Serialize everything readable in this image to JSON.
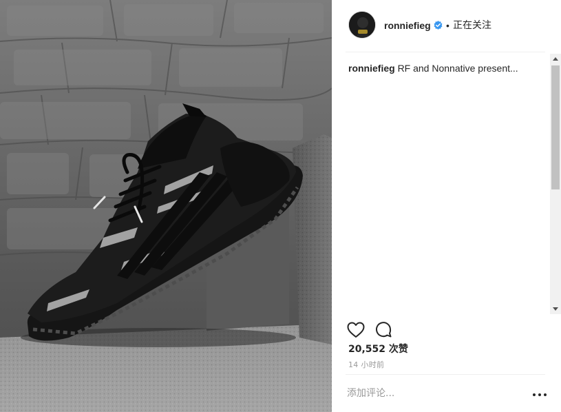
{
  "post": {
    "username": "ronniefieg",
    "verified": true,
    "separator": "•",
    "follow_status": "正在关注",
    "caption_user": "ronniefieg",
    "caption_text": "RF and Nonnative present...",
    "likes": "20,552 次赞",
    "timestamp": "14 小时前"
  },
  "comment_input": {
    "placeholder": "添加评论..."
  },
  "icons": {
    "avatar": "avatar-photo",
    "verified": "verified-badge-icon",
    "like": "heart-outline-icon",
    "comment": "speech-bubble-icon",
    "more": "more-options-icon"
  },
  "colors": {
    "verified_blue": "#3897f0",
    "text": "#262626",
    "muted": "#999999",
    "divider": "#efefef"
  }
}
